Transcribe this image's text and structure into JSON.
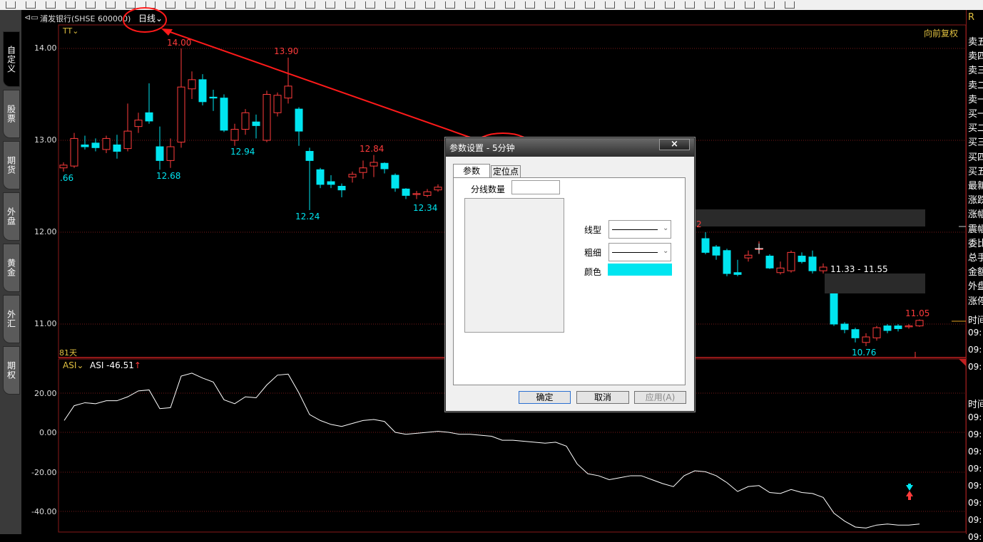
{
  "header": {
    "stock_label": "浦发银行(SHSE 600000)",
    "period": "日线",
    "indicator": "TT",
    "restore": "向前复权",
    "days": "81天"
  },
  "left_tabs": [
    "自定义",
    "股票",
    "期货",
    "外盘",
    "黄金",
    "外汇",
    "期权"
  ],
  "price_axis": [
    "14.00",
    "13.00",
    "12.00",
    "11.00"
  ],
  "annotations": {
    "high1": "14.00",
    "low1": "12.68",
    "high2": "13.90",
    "low2": "12.94",
    "low3": "12.24",
    "high3": "12.84",
    "low4": "12.34",
    "left_cut": ".66",
    "partial": "2",
    "range": "11.33 - 11.55",
    "last_high": "11.05",
    "last_low": "10.76"
  },
  "sub_chart": {
    "indicator": "ASI",
    "value_label": "ASI -46.51",
    "axis": [
      "20.00",
      "0.00",
      "-20.00",
      "-40.00"
    ]
  },
  "right_panel": {
    "top": "R",
    "rows": [
      "卖五",
      "卖四",
      "卖三",
      "卖二",
      "卖一",
      "买一",
      "买二",
      "买三",
      "买四",
      "买五",
      "最新",
      "涨跌",
      "涨幅",
      "震幅",
      "委比",
      "总手",
      "金额",
      "外盘",
      "涨停"
    ],
    "time_header": "时间",
    "times": [
      "09:",
      "09:",
      "09:"
    ],
    "time_header2": "时间",
    "times2": [
      "09:",
      "09:",
      "09:",
      "09:",
      "09:",
      "09:",
      "09:",
      "09:"
    ]
  },
  "dialog": {
    "title": "参数设置 - 5分钟",
    "tab_params": "参数",
    "tab_anchor": "定位点",
    "count_label": "分线数量",
    "count_value": "",
    "line_type_label": "线型",
    "thickness_label": "粗细",
    "color_label": "颜色",
    "color_value": "#00e5f0",
    "ok": "确定",
    "cancel": "取消",
    "apply": "应用(A)"
  },
  "colors": {
    "up": "#ff3b3b",
    "down": "#00e5f0",
    "annotation": "#ff1a1a"
  }
}
